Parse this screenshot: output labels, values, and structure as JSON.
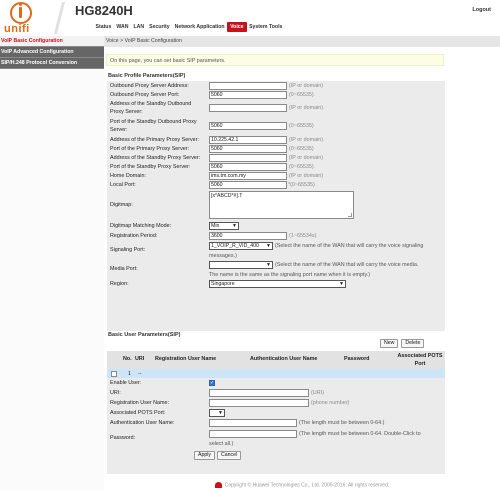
{
  "header": {
    "logo_text": "unifi",
    "model": "HG8240H",
    "logout_label": "Logout",
    "nav": [
      "Status",
      "WAN",
      "LAN",
      "Security",
      "Network Application",
      "Voice",
      "System Tools"
    ],
    "active_nav": "Voice"
  },
  "sidebar": {
    "items": [
      "VoIP Basic Configuration",
      "VoIP Advanced Configuration",
      "SIP/H.248 Protocol Conversion"
    ]
  },
  "breadcrumb": "Voice > VoIP Basic Configuration",
  "notice": "On this page, you can set basic SIP parameters.",
  "basic_profile": {
    "title": "Basic Profile Parameters(SIP)",
    "fields": {
      "outbound_proxy_address": {
        "label": "Outbound Proxy Server Address:",
        "value": "",
        "hint": "(IP or domain)"
      },
      "outbound_proxy_port": {
        "label": "Outbound Proxy Server Port:",
        "value": "5060",
        "hint": "(0~65535)"
      },
      "standby_outbound_address": {
        "label1": "Address of the Standby Outbound",
        "label2": "Proxy Server:",
        "value": "",
        "hint": "(IP or domain)"
      },
      "standby_outbound_port": {
        "label1": "Port of the Standby Outbound Proxy",
        "label2": "Server:",
        "value": "5060",
        "hint": "(0~65535)"
      },
      "primary_proxy_address": {
        "label": "Address of the Primary Proxy Server:",
        "value": "10.225.42.1",
        "hint": "(IP or domain)"
      },
      "primary_proxy_port": {
        "label": "Port of the Primary Proxy Server:",
        "value": "5060",
        "hint": "(0~65535)"
      },
      "standby_proxy_address": {
        "label": "Address of the Standby Proxy Server:",
        "value": "",
        "hint": "(IP or domain)"
      },
      "standby_proxy_port": {
        "label": "Port of the Standby Proxy Server:",
        "value": "5060",
        "hint": "(0~65535)"
      },
      "home_domain": {
        "label": "Home Domain:",
        "value": "ims.tm.com.my",
        "hint": "(IP or domain)"
      },
      "local_port": {
        "label": "Local Port:",
        "value": "5060",
        "hint": "*(0~65535)"
      },
      "digitmap": {
        "label": "Digitmap:",
        "value": "[x*ABCD*#].T"
      },
      "digitmap_mode": {
        "label": "Digitmap Matching Mode:",
        "value": "Min"
      },
      "registration_period": {
        "label": "Registration Period:",
        "value": "3600",
        "hint": "(1~65534s)"
      },
      "signaling_port": {
        "label": "Signaling Port:",
        "value": "1_VOIP_R_VID_400",
        "hint1": "(Select the name of the WAN that will carry the voice signaling",
        "hint2": "messages.)"
      },
      "media_port": {
        "label": "Media Port:",
        "value": "",
        "hint1": "(Select the name of the WAN that will carry the voice media.",
        "hint2": "The name is the same as the signaling port name when it is empty.)"
      },
      "region": {
        "label": "Region:",
        "value": "Singapore"
      }
    }
  },
  "basic_user": {
    "title": "Basic User Parameters(SIP)",
    "new_label": "New",
    "delete_label": "Delete",
    "columns": [
      "No.",
      "URI",
      "Registration User Name",
      "Authentication User Name",
      "Password",
      "Associated POTS Port"
    ],
    "rows": [
      {
        "no": "1",
        "uri": "--"
      }
    ],
    "fields": {
      "enable_user": {
        "label": "Enable User:",
        "checked": true
      },
      "uri": {
        "label": "URI:",
        "value": "",
        "hint": "(URI)"
      },
      "registration_user_name": {
        "label": "Registration User Name:",
        "value": "",
        "hint": "(phone number)"
      },
      "associated_pots_port": {
        "label": "Associated POTS Port:",
        "value": ""
      },
      "auth_user_name": {
        "label": "Authentication User Name:",
        "value": "",
        "hint": "(The length must be between 0-64.)"
      },
      "password": {
        "label": "Password:",
        "value": "",
        "hint1": "(The length must be between 0-64. Double-Click to",
        "hint2": "select all.)"
      }
    },
    "apply_label": "Apply",
    "cancel_label": "Cancel"
  },
  "footer": "Copyright © Huawei Technologies Co., Ltd. 2009-2016. All rights reserved.",
  "colors": {
    "accent": "#c8111c",
    "brand": "#e06a1b",
    "sidebar": "#666666",
    "row_selected": "#cde6f7"
  }
}
